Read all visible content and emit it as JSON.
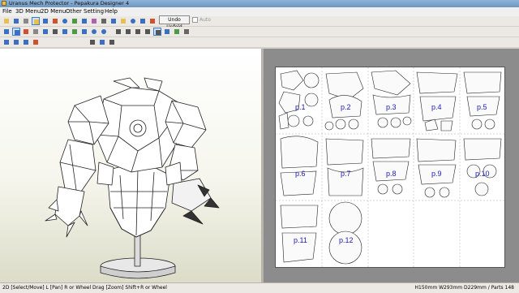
{
  "window": {
    "title": "Uranus Mech Protector - Pepakura Designer 4"
  },
  "menu": {
    "file": "File",
    "menu3d": "3D Menu",
    "menu2d": "2D Menu",
    "other": "Other",
    "setting": "Setting",
    "help": "Help"
  },
  "toolbar": {
    "undo_unfold": "Undo Unfold",
    "auto_label": "Auto",
    "auto_checked": false
  },
  "sheet": {
    "page_labels": [
      "p.1",
      "p.2",
      "p.3",
      "p.4",
      "p.5",
      "p.6",
      "p.7",
      "p.8",
      "p.9",
      "p.10",
      "p.11",
      "p.12"
    ]
  },
  "status": {
    "left": "2D [Select/Move] L [Pan] R or Wheel Drag [Zoom] Shift+R or Wheel",
    "right": "H150mm W293mm D229mm / Parts 148"
  },
  "colors": {
    "title_bar": "#7da6cf",
    "canvas_bg": "#8c8c8c",
    "page_label": "#1a1ab0",
    "active_tool": "#3a7bd5"
  }
}
